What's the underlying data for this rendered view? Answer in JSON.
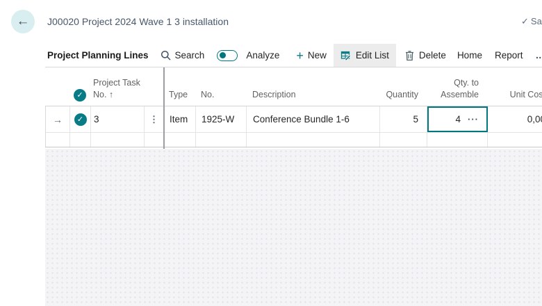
{
  "colors": {
    "accent_teal": "#00767e",
    "check_circle": "#077c86",
    "title_text": "#47586b",
    "header_text": "#616161",
    "selected_cell_border": "#00767e",
    "editlist_active_bg": "#ececec"
  },
  "header": {
    "back_icon": "←",
    "title": "J00020 Project 2024 Wave 1 3 installation",
    "save_check": "✓",
    "save_status": "Saved"
  },
  "toolbar": {
    "caption": "Project Planning Lines",
    "search_label": "Search",
    "analyze_label": "Analyze",
    "new_label": "New",
    "edit_list_label": "Edit List",
    "delete_label": "Delete",
    "home_label": "Home",
    "report_label": "Report",
    "more_label": "…"
  },
  "table": {
    "select_all_icon": "✓",
    "columns": [
      {
        "key": "task_no",
        "label": "Project Task No. ↑"
      },
      {
        "key": "type",
        "label": "Type"
      },
      {
        "key": "no",
        "label": "No."
      },
      {
        "key": "description",
        "label": "Description"
      },
      {
        "key": "quantity",
        "label": "Quantity"
      },
      {
        "key": "qty_to_assemble",
        "label": "Qty. to Assemble"
      },
      {
        "key": "unit_cost",
        "label": "Unit Cost"
      }
    ],
    "rows": [
      {
        "row_indicator": "→",
        "selected_icon": "✓",
        "task_no": "3",
        "row_menu": "⋮",
        "type": "Item",
        "no": "1925-W",
        "description": "Conference Bundle 1-6",
        "quantity": "5",
        "qty_to_assemble": "4",
        "assist_edit": "···",
        "unit_cost": "0,00"
      }
    ]
  }
}
